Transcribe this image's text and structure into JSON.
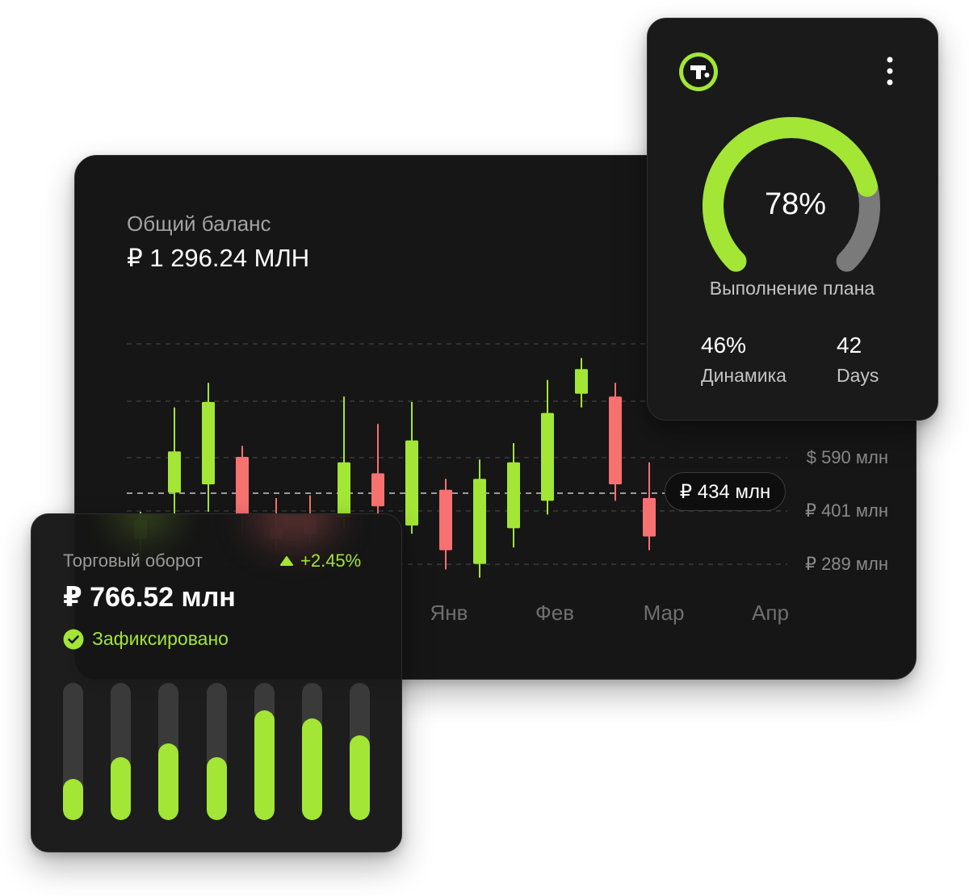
{
  "colors": {
    "accent": "#a3e635",
    "negative": "#f87171",
    "card": "#161616",
    "track": "#3a3a3a"
  },
  "balance_card": {
    "label": "Общий баланс",
    "value": "₽ 1 296.24 МЛН",
    "price_marker": "₽ 434 млн"
  },
  "plan_card": {
    "logo_icon": "tinkoff-logo-icon",
    "menu_icon": "more-vertical-icon",
    "percent_label": "78%",
    "label": "Выполнение плана",
    "stat1_value": "46%",
    "stat1_label": "Динамика",
    "stat2_value": "42",
    "stat2_label": "Days"
  },
  "turnover_card": {
    "label": "Торговый оборот",
    "change": "+2.45%",
    "change_icon": "triangle-up-icon",
    "value": "₽ 766.52 млн",
    "status": "Зафиксировано",
    "status_icon": "check-circle-icon"
  },
  "chart_data": [
    {
      "type": "candlestick",
      "y_ticks": [
        "$ 590 млн",
        "₽ 401 млн",
        "₽ 289 млн"
      ],
      "x_ticks": [
        "Янв",
        "Фев",
        "Мар",
        "Апр"
      ],
      "current_value_label": "₽ 434 млн",
      "candles": [
        {
          "open": 400,
          "close": 435,
          "high": 450,
          "low": 360
        },
        {
          "open": 485,
          "close": 560,
          "high": 640,
          "low": 440
        },
        {
          "open": 500,
          "close": 650,
          "high": 685,
          "low": 450
        },
        {
          "open": 550,
          "close": 445,
          "high": 570,
          "low": 410
        },
        {
          "open": 420,
          "close": 400,
          "high": 475,
          "low": 380
        },
        {
          "open": 435,
          "close": 410,
          "high": 480,
          "low": 395
        },
        {
          "open": 440,
          "close": 540,
          "high": 660,
          "low": 420
        },
        {
          "open": 520,
          "close": 460,
          "high": 610,
          "low": 440
        },
        {
          "open": 425,
          "close": 580,
          "high": 650,
          "low": 410
        },
        {
          "open": 490,
          "close": 380,
          "high": 510,
          "low": 345
        },
        {
          "open": 355,
          "close": 510,
          "high": 545,
          "low": 330
        },
        {
          "open": 420,
          "close": 540,
          "high": 575,
          "low": 385
        },
        {
          "open": 470,
          "close": 630,
          "high": 690,
          "low": 445
        },
        {
          "open": 665,
          "close": 710,
          "high": 730,
          "low": 640
        },
        {
          "open": 660,
          "close": 500,
          "high": 685,
          "low": 470
        },
        {
          "open": 475,
          "close": 405,
          "high": 540,
          "low": 380
        }
      ]
    },
    {
      "type": "gauge",
      "value": 78,
      "max": 100,
      "label": "Выполнение плана"
    },
    {
      "type": "bar",
      "values": [
        0.3,
        0.46,
        0.56,
        0.46,
        0.8,
        0.74,
        0.62
      ],
      "max": 1
    }
  ]
}
